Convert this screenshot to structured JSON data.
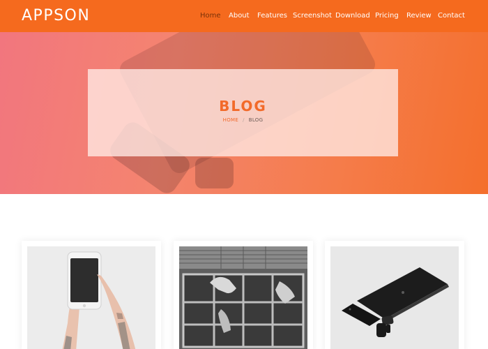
{
  "header": {
    "logo": "APPSON",
    "nav": [
      {
        "label": "Home",
        "active": true
      },
      {
        "label": "About",
        "active": false
      },
      {
        "label": "Features",
        "active": false
      },
      {
        "label": "Screenshot",
        "active": false
      },
      {
        "label": "Download",
        "active": false
      },
      {
        "label": "Pricing",
        "active": false
      },
      {
        "label": "Review",
        "active": false
      },
      {
        "label": "Contact",
        "active": false
      }
    ]
  },
  "hero": {
    "title": "BLOG",
    "breadcrumb": {
      "home": "HOME",
      "separator": "/",
      "current": "BLOG"
    }
  },
  "blog": {
    "cards": [
      {
        "image": "hands-holding-smartphone-photo"
      },
      {
        "image": "black-and-white-hands-on-window-photo"
      },
      {
        "image": "laptop-phone-smartwatch-photo"
      }
    ]
  },
  "colors": {
    "brand_orange": "#f56a1e",
    "active_nav": "#7a3208",
    "title_orange": "#f26a2a"
  }
}
